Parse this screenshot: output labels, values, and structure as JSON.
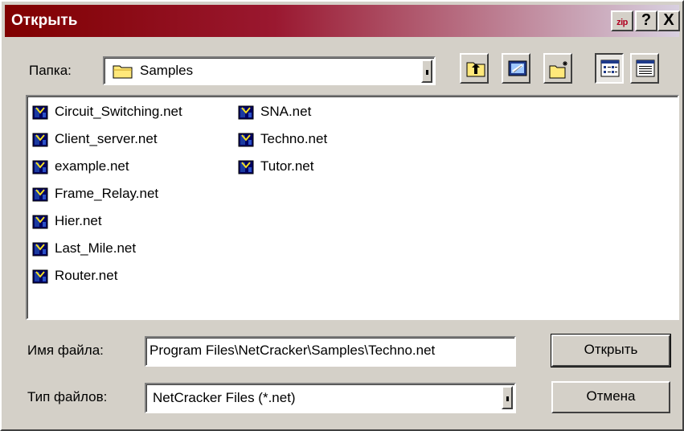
{
  "window": {
    "title": "Открыть",
    "controls": {
      "zip_label": "zip",
      "help_label": "?",
      "close_label": "X"
    },
    "title_gradient": [
      "#800000",
      "#d8d0e0"
    ]
  },
  "folder_bar": {
    "label": "Папка:",
    "current_folder": "Samples",
    "folder_icon": "folder-icon",
    "tools": [
      {
        "name": "up-one-level-icon"
      },
      {
        "name": "desktop-icon"
      },
      {
        "name": "new-folder-icon"
      },
      {
        "name": "list-view-icon",
        "active": true
      },
      {
        "name": "details-view-icon"
      }
    ]
  },
  "file_list": {
    "icon": "netcracker-file-icon",
    "columns": [
      [
        "Circuit_Switching.net",
        "Client_server.net",
        "example.net",
        "Frame_Relay.net",
        "Hier.net",
        "Last_Mile.net",
        "Router.net"
      ],
      [
        "SNA.net",
        "Techno.net",
        "Tutor.net"
      ]
    ]
  },
  "filename": {
    "label": "Имя файла:",
    "value": "Program Files\\NetCracker\\Samples\\Techno.net"
  },
  "filetype": {
    "label": "Тип файлов:",
    "value": "NetCracker Files (*.net)"
  },
  "buttons": {
    "open": "Открыть",
    "cancel": "Отмена"
  }
}
